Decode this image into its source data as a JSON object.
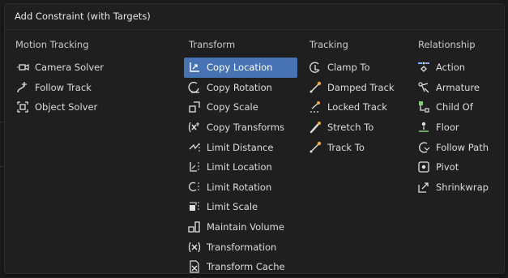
{
  "title": "Add Constraint (with Targets)",
  "columns": [
    {
      "header": "Motion Tracking",
      "items": [
        {
          "label": "Camera Solver",
          "icon": "camera-solver-icon"
        },
        {
          "label": "Follow Track",
          "icon": "follow-track-icon"
        },
        {
          "label": "Object Solver",
          "icon": "object-solver-icon"
        }
      ]
    },
    {
      "header": "Transform",
      "items": [
        {
          "label": "Copy Location",
          "icon": "copy-location-icon",
          "highlighted": true
        },
        {
          "label": "Copy Rotation",
          "icon": "copy-rotation-icon"
        },
        {
          "label": "Copy Scale",
          "icon": "copy-scale-icon"
        },
        {
          "label": "Copy Transforms",
          "icon": "copy-transforms-icon"
        },
        {
          "label": "Limit Distance",
          "icon": "limit-distance-icon"
        },
        {
          "label": "Limit Location",
          "icon": "limit-location-icon"
        },
        {
          "label": "Limit Rotation",
          "icon": "limit-rotation-icon"
        },
        {
          "label": "Limit Scale",
          "icon": "limit-scale-icon"
        },
        {
          "label": "Maintain Volume",
          "icon": "maintain-volume-icon"
        },
        {
          "label": "Transformation",
          "icon": "transformation-icon"
        },
        {
          "label": "Transform Cache",
          "icon": "transform-cache-icon"
        }
      ]
    },
    {
      "header": "Tracking",
      "items": [
        {
          "label": "Clamp To",
          "icon": "clamp-to-icon"
        },
        {
          "label": "Damped Track",
          "icon": "damped-track-icon"
        },
        {
          "label": "Locked Track",
          "icon": "locked-track-icon"
        },
        {
          "label": "Stretch To",
          "icon": "stretch-to-icon"
        },
        {
          "label": "Track To",
          "icon": "track-to-icon"
        }
      ]
    },
    {
      "header": "Relationship",
      "items": [
        {
          "label": "Action",
          "icon": "action-icon"
        },
        {
          "label": "Armature",
          "icon": "armature-icon"
        },
        {
          "label": "Child Of",
          "icon": "child-of-icon"
        },
        {
          "label": "Floor",
          "icon": "floor-icon"
        },
        {
          "label": "Follow Path",
          "icon": "follow-path-icon"
        },
        {
          "label": "Pivot",
          "icon": "pivot-icon"
        },
        {
          "label": "Shrinkwrap",
          "icon": "shrinkwrap-icon"
        }
      ]
    }
  ],
  "colors": {
    "background": "#1f1f1f",
    "highlight": "#4772b3",
    "text": "#dcdcdc",
    "icon": "#e0e0e0",
    "icon_accent": "#f3a64a",
    "icon_green": "#7ad46e"
  }
}
